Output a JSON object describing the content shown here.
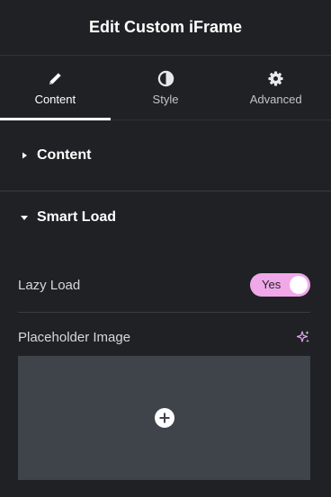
{
  "header": {
    "title": "Edit Custom iFrame"
  },
  "tabs": [
    {
      "label": "Content",
      "icon": "pencil-icon",
      "active": true
    },
    {
      "label": "Style",
      "icon": "half-circle-icon",
      "active": false
    },
    {
      "label": "Advanced",
      "icon": "gear-icon",
      "active": false
    }
  ],
  "sections": [
    {
      "label": "Content",
      "state": "collapsed"
    },
    {
      "label": "Smart Load",
      "state": "expanded"
    }
  ],
  "controls": {
    "lazy_load": {
      "label": "Lazy Load",
      "value": "Yes",
      "on": true
    },
    "placeholder": {
      "label": "Placeholder Image",
      "ai_icon": "sparkle-icon",
      "add_icon": "plus-circle-icon"
    }
  },
  "colors": {
    "background": "#1f2124",
    "accent": "#f0a8e9",
    "media_bg": "#3f444b"
  }
}
